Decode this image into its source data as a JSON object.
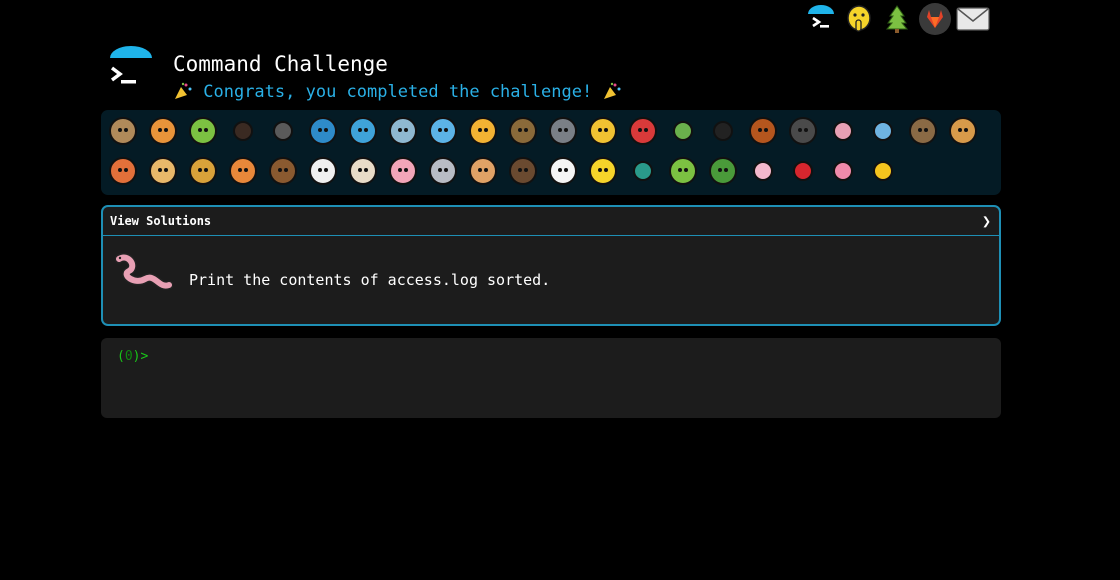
{
  "nav": {
    "icons": [
      "terminal-logo-icon",
      "shushing-face-icon",
      "tree-icon",
      "gitlab-icon",
      "mail-icon"
    ]
  },
  "header": {
    "title": "Command Challenge",
    "congrats": "Congrats, you completed the challenge!"
  },
  "badges": {
    "row1": [
      "snail",
      "butterfly",
      "caterpillar",
      "ant",
      "spider-web",
      "whale",
      "dolphin",
      "dolphin-2",
      "fish",
      "tropical-fish",
      "blowfish",
      "wolf",
      "bee",
      "ladybug",
      "cricket",
      "spider",
      "scorpion",
      "fly",
      "worm",
      "microbe",
      "monkey",
      "dog"
    ],
    "row2": [
      "fox",
      "cat",
      "lion",
      "tiger",
      "horse",
      "unicorn",
      "cow",
      "pig",
      "mouse",
      "hamster",
      "bear",
      "panda",
      "hatching-chick",
      "peacock",
      "frog",
      "dragon",
      "cherry-blossom",
      "rose",
      "hibiscus",
      "sunflower"
    ]
  },
  "solutions": {
    "label": "View Solutions",
    "chevron": "❯",
    "task": "Print the contents of access.log sorted."
  },
  "terminal": {
    "prompt_num": "0",
    "prompt_open": "(",
    "prompt_close": ")>"
  },
  "colors": {
    "accent": "#2ab0e6",
    "panel_border": "#1e8fb5",
    "prompt_green": "#19c719"
  }
}
